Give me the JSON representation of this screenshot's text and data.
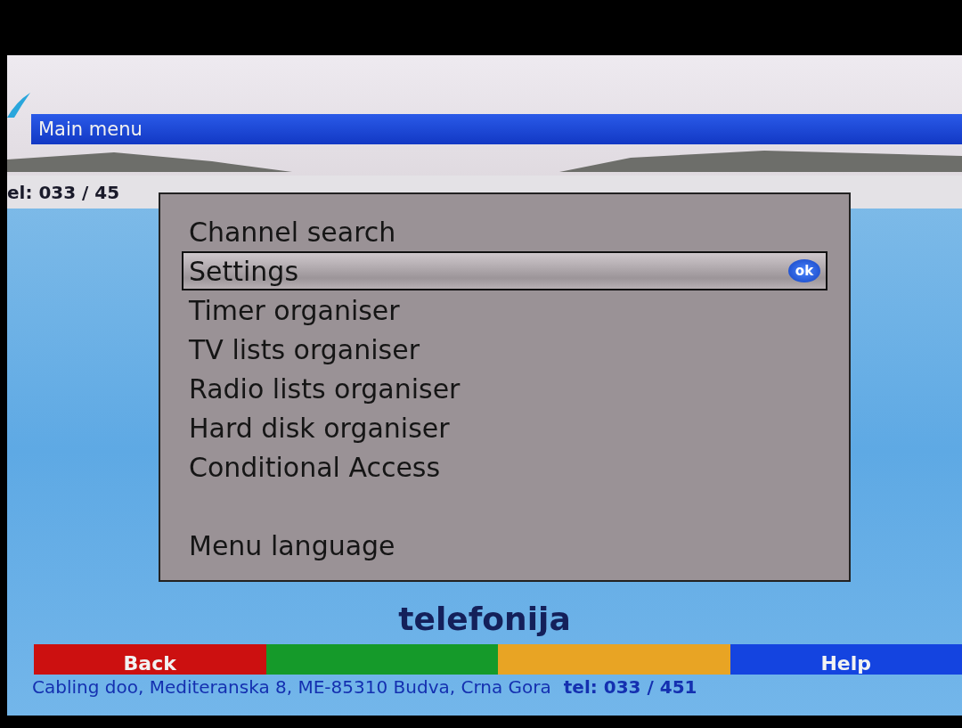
{
  "background": {
    "phone_fragment": "el: 033 / 45",
    "slogan": "telefonija",
    "footer": "Cabling doo, Mediteranska 8, ME-85310 Budva, Crna Gora",
    "footer_phone": "tel: 033 / 451"
  },
  "title": "Main menu",
  "menu": {
    "sections": [
      [
        {
          "label": "Channel search",
          "selected": false
        },
        {
          "label": "Settings",
          "selected": true,
          "badge": "ok"
        },
        {
          "label": "Timer organiser",
          "selected": false
        },
        {
          "label": "TV lists organiser",
          "selected": false
        },
        {
          "label": "Radio lists organiser",
          "selected": false
        },
        {
          "label": "Hard disk organiser",
          "selected": false
        },
        {
          "label": "Conditional Access",
          "selected": false
        }
      ],
      [
        {
          "label": "Menu language",
          "selected": false
        }
      ]
    ]
  },
  "color_keys": [
    {
      "label": "Back",
      "color": "#cc1010"
    },
    {
      "color": "#159a2a"
    },
    {
      "color": "#e8a424"
    },
    {
      "label": "Help",
      "color": "#1444e0"
    }
  ]
}
